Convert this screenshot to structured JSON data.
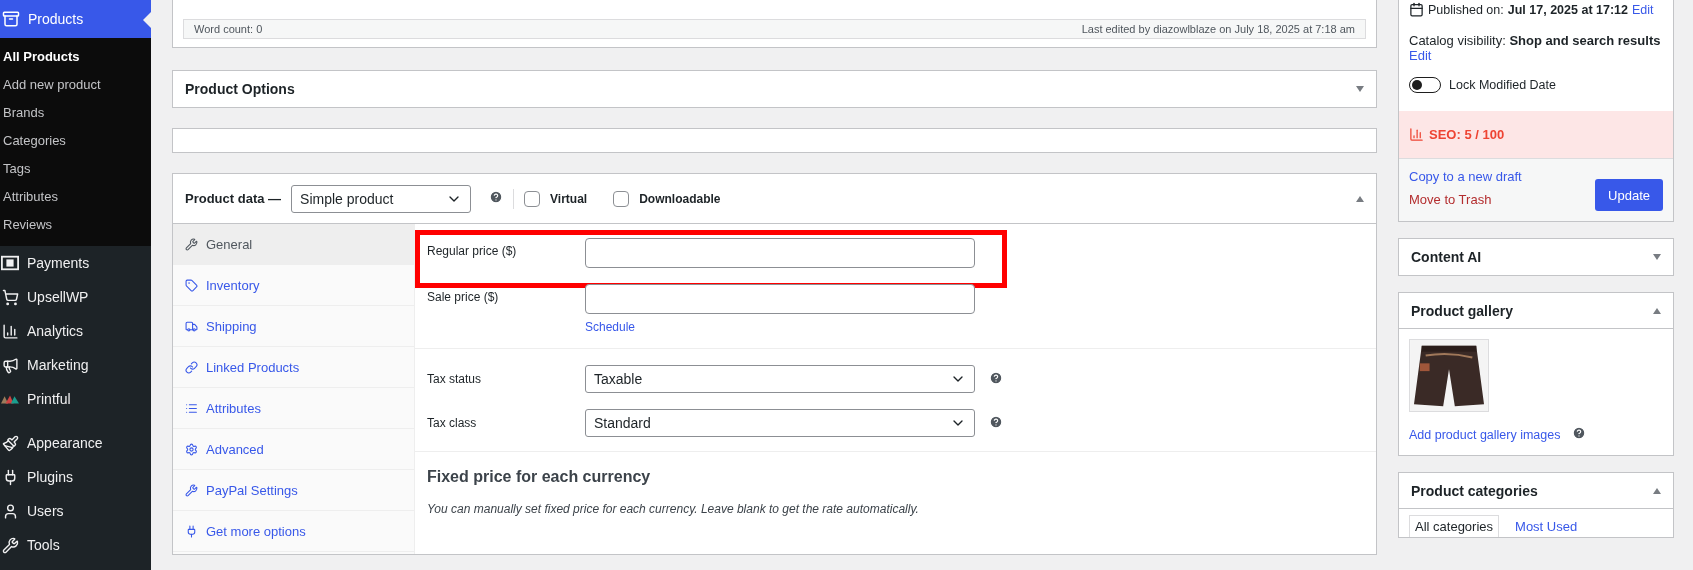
{
  "admin_menu": {
    "current": {
      "label": "Products",
      "selected": true
    },
    "submenu": [
      {
        "label": "All Products",
        "selected": true
      },
      {
        "label": "Add new product",
        "selected": false
      },
      {
        "label": "Brands",
        "selected": false
      },
      {
        "label": "Categories",
        "selected": false
      },
      {
        "label": "Tags",
        "selected": false
      },
      {
        "label": "Attributes",
        "selected": false
      },
      {
        "label": "Reviews",
        "selected": false
      }
    ],
    "items": [
      {
        "label": "Payments",
        "kind": "payments"
      },
      {
        "label": "UpsellWP",
        "kind": "cart"
      },
      {
        "label": "Analytics",
        "kind": "analytics"
      },
      {
        "label": "Marketing",
        "kind": "marketing"
      },
      {
        "label": "Printful",
        "kind": "printful"
      },
      {
        "label": "Appearance",
        "kind": "appearance"
      },
      {
        "label": "Plugins",
        "kind": "plugins"
      },
      {
        "label": "Users",
        "kind": "users"
      },
      {
        "label": "Tools",
        "kind": "tools"
      }
    ]
  },
  "editor_status": {
    "word_count": "Word count: 0",
    "last_edited": "Last edited by diazowlblaze on July 18, 2025 at 7:18 am"
  },
  "product_options": {
    "title": "Product Options",
    "expanded": false
  },
  "product_data": {
    "title": "Product data —",
    "type_select": "Simple product",
    "virtual": {
      "label": "Virtual",
      "checked": false
    },
    "downloadable": {
      "label": "Downloadable",
      "checked": false
    },
    "expanded": true,
    "tabs": [
      {
        "label": "General",
        "kind": "wrench",
        "selected": true
      },
      {
        "label": "Inventory",
        "kind": "tag",
        "selected": false
      },
      {
        "label": "Shipping",
        "kind": "truck",
        "selected": false
      },
      {
        "label": "Linked Products",
        "kind": "link",
        "selected": false
      },
      {
        "label": "Attributes",
        "kind": "list",
        "selected": false
      },
      {
        "label": "Advanced",
        "kind": "gear",
        "selected": false
      },
      {
        "label": "PayPal Settings",
        "kind": "wrench",
        "selected": false
      },
      {
        "label": "Get more options",
        "kind": "plug",
        "selected": false
      }
    ],
    "regular_price": {
      "label": "Regular price ($)",
      "highlighted": true
    },
    "sale_price": {
      "label": "Sale price ($)",
      "link": "Schedule"
    },
    "tax_status": {
      "label": "Tax status",
      "value": "Taxable"
    },
    "tax_class": {
      "label": "Tax class",
      "value": "Standard"
    },
    "fixed_price": {
      "title": "Fixed price for each currency",
      "note": "You can manually set fixed price for each currency. Leave blank to get the rate automatically."
    }
  },
  "publish": {
    "published_label": "Published on:",
    "published_value": "Jul 17, 2025 at 17:12",
    "published_edit": "Edit",
    "visibility_label": "Catalog visibility:",
    "visibility_value": "Shop and search results",
    "visibility_edit": "Edit",
    "lock_modified": {
      "label": "Lock Modified Date",
      "on": false
    },
    "seo": "SEO: 5 / 100",
    "copy_draft": "Copy to a new draft",
    "trash": "Move to Trash",
    "update": "Update"
  },
  "content_ai": {
    "title": "Content AI",
    "expanded": false
  },
  "product_gallery": {
    "title": "Product gallery",
    "expanded": true,
    "add_link": "Add product gallery images"
  },
  "product_categories": {
    "title": "Product categories",
    "expanded": true,
    "tabs": [
      {
        "label": "All categories",
        "selected": true
      },
      {
        "label": "Most Used",
        "selected": false
      }
    ]
  }
}
